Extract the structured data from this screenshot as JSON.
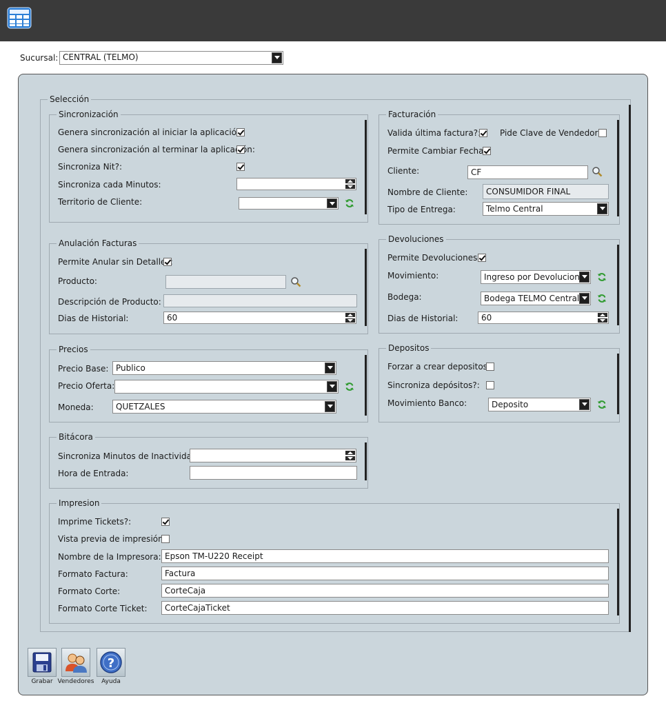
{
  "sucursal": {
    "label": "Sucursal:",
    "value": "CENTRAL (TELMO)"
  },
  "seleccion": {
    "title": "Selección"
  },
  "sincronizacion": {
    "title": "Sincronización",
    "inicio_label": "Genera sincronización al iniciar la aplicación:",
    "inicio_checked": true,
    "termino_label": "Genera sincronización al terminar la aplicación:",
    "termino_checked": true,
    "nit_label": "Sincroniza Nit?:",
    "nit_checked": true,
    "minutos_label": "Sincroniza cada Minutos:",
    "minutos_value": "",
    "territorio_label": "Territorio de Cliente:",
    "territorio_value": ""
  },
  "facturacion": {
    "title": "Facturación",
    "valida_label": "Valida última factura?:",
    "valida_checked": true,
    "pide_clave_label": "Pide Clave de Vendedor?:",
    "pide_clave_checked": false,
    "cambiar_fecha_label": "Permite Cambiar Fecha?:",
    "cambiar_fecha_checked": true,
    "cliente_label": "Cliente:",
    "cliente_value": "CF",
    "nombre_label": "Nombre de Cliente:",
    "nombre_value": "CONSUMIDOR FINAL",
    "tipo_entrega_label": "Tipo de Entrega:",
    "tipo_entrega_value": "Telmo Central"
  },
  "anulacion": {
    "title": "Anulación Facturas",
    "sin_detalle_label": "Permite Anular sin Detalle?:",
    "sin_detalle_checked": true,
    "producto_label": "Producto:",
    "producto_value": "",
    "descripcion_label": "Descripción de Producto:",
    "descripcion_value": "",
    "historial_label": "Dias de Historial:",
    "historial_value": "60"
  },
  "devoluciones": {
    "title": "Devoluciones",
    "permite_label": "Permite Devoluciones?:",
    "permite_checked": true,
    "movimiento_label": "Movimiento:",
    "movimiento_value": "Ingreso por Devolucion",
    "bodega_label": "Bodega:",
    "bodega_value": "Bodega TELMO Central",
    "historial_label": "Dias de Historial:",
    "historial_value": "60"
  },
  "precios": {
    "title": "Precios",
    "base_label": "Precio Base:",
    "base_value": "Publico",
    "oferta_label": "Precio Oferta:",
    "oferta_value": "",
    "moneda_label": "Moneda:",
    "moneda_value": "QUETZALES"
  },
  "depositos": {
    "title": "Depositos",
    "forzar_label": "Forzar a crear depositos?:",
    "forzar_checked": false,
    "sincroniza_label": "Sincroniza depósitos?:",
    "sincroniza_checked": false,
    "banco_label": "Movimiento Banco:",
    "banco_value": "Deposito"
  },
  "bitacora": {
    "title": "Bitácora",
    "inactividad_label": "Sincroniza Minutos de Inactividad:",
    "inactividad_value": "",
    "hora_label": "Hora de Entrada:",
    "hora_value": ""
  },
  "impresion": {
    "title": "Impresion",
    "tickets_label": "Imprime Tickets?:",
    "tickets_checked": true,
    "vista_previa_label": "Vista previa de impresión?:",
    "vista_previa_checked": false,
    "impresora_label": "Nombre de la Impresora:",
    "impresora_value": "Epson TM-U220 Receipt",
    "factura_label": "Formato Factura:",
    "factura_value": "Factura",
    "corte_label": "Formato Corte:",
    "corte_value": "CorteCaja",
    "corte_ticket_label": "Formato Corte Ticket:",
    "corte_ticket_value": "CorteCajaTicket"
  },
  "toolbar": {
    "grabar": "Grabar",
    "vendedores": "Vendedores",
    "ayuda": "Ayuda"
  },
  "icons": {
    "app": "table-grid-icon",
    "save": "floppy-disk-icon",
    "users": "users-icon",
    "help": "help-icon",
    "refresh": "refresh-icon",
    "search": "magnifier-icon"
  },
  "colors": {
    "titlebar": "#3a3a3a",
    "panel": "#cbd6dc",
    "refresh_green": "#2e9a2e"
  }
}
